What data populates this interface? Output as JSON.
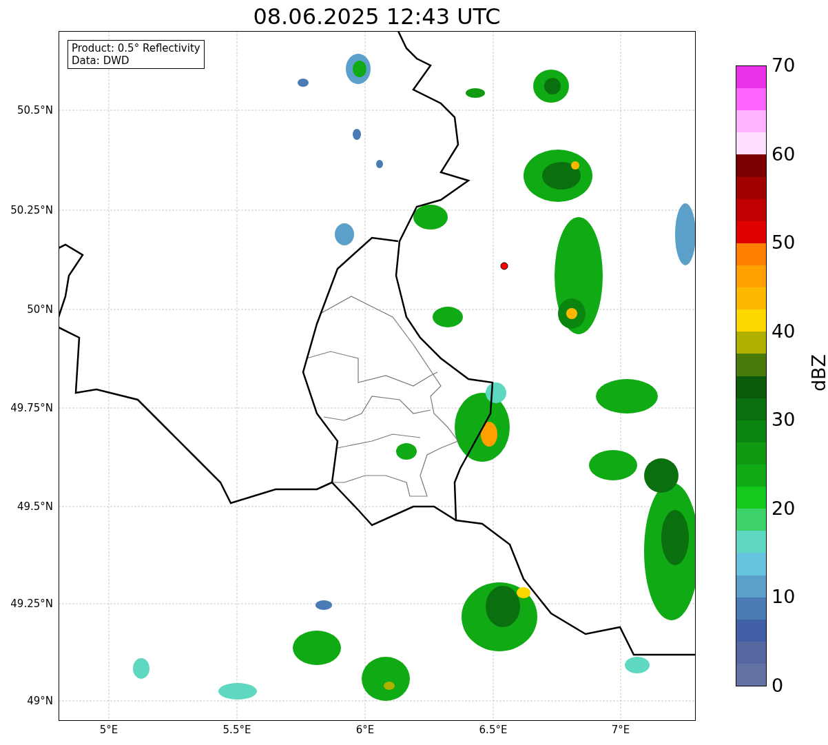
{
  "title": "08.06.2025 12:43 UTC",
  "info_box": [
    "Product: 0.5° Reflectivity",
    "Data: DWD"
  ],
  "y_ticks": [
    "50.5°N",
    "50.25°N",
    "50°N",
    "49.75°N",
    "49.5°N",
    "49.25°N",
    "49°N"
  ],
  "x_ticks": [
    "5°E",
    "5.5°E",
    "6°E",
    "6.5°E",
    "7°E"
  ],
  "colorbar": {
    "label": "dBZ",
    "ticks": [
      "70",
      "60",
      "50",
      "40",
      "30",
      "20",
      "10",
      "0"
    ]
  }
}
